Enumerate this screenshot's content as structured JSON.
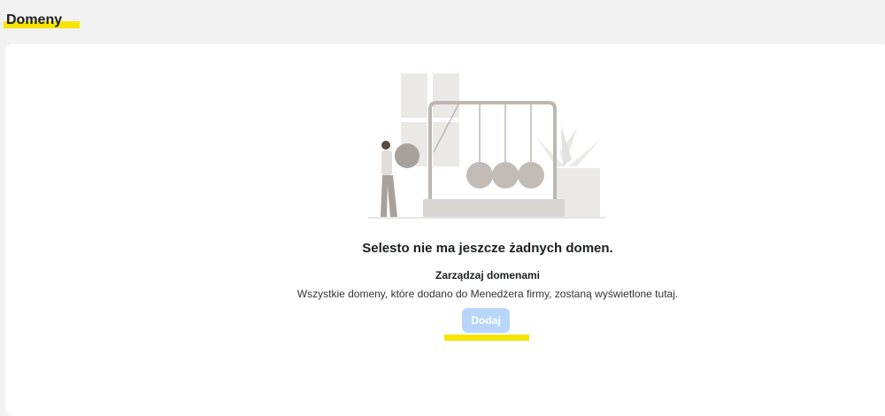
{
  "page": {
    "title": "Domeny"
  },
  "empty_state": {
    "heading": "Selesto nie ma jeszcze żadnych domen.",
    "subheading": "Zarządzaj domenami",
    "description": "Wszystkie domeny, które dodano do Menedżera firmy, zostaną wyświetlone tutaj.",
    "add_button_label": "Dodaj"
  },
  "colors": {
    "highlight": "#f7e400",
    "button_disabled": "#b8d6fb",
    "illustration_gray": "#e8e6e3",
    "illustration_dark": "#a8a09a"
  }
}
